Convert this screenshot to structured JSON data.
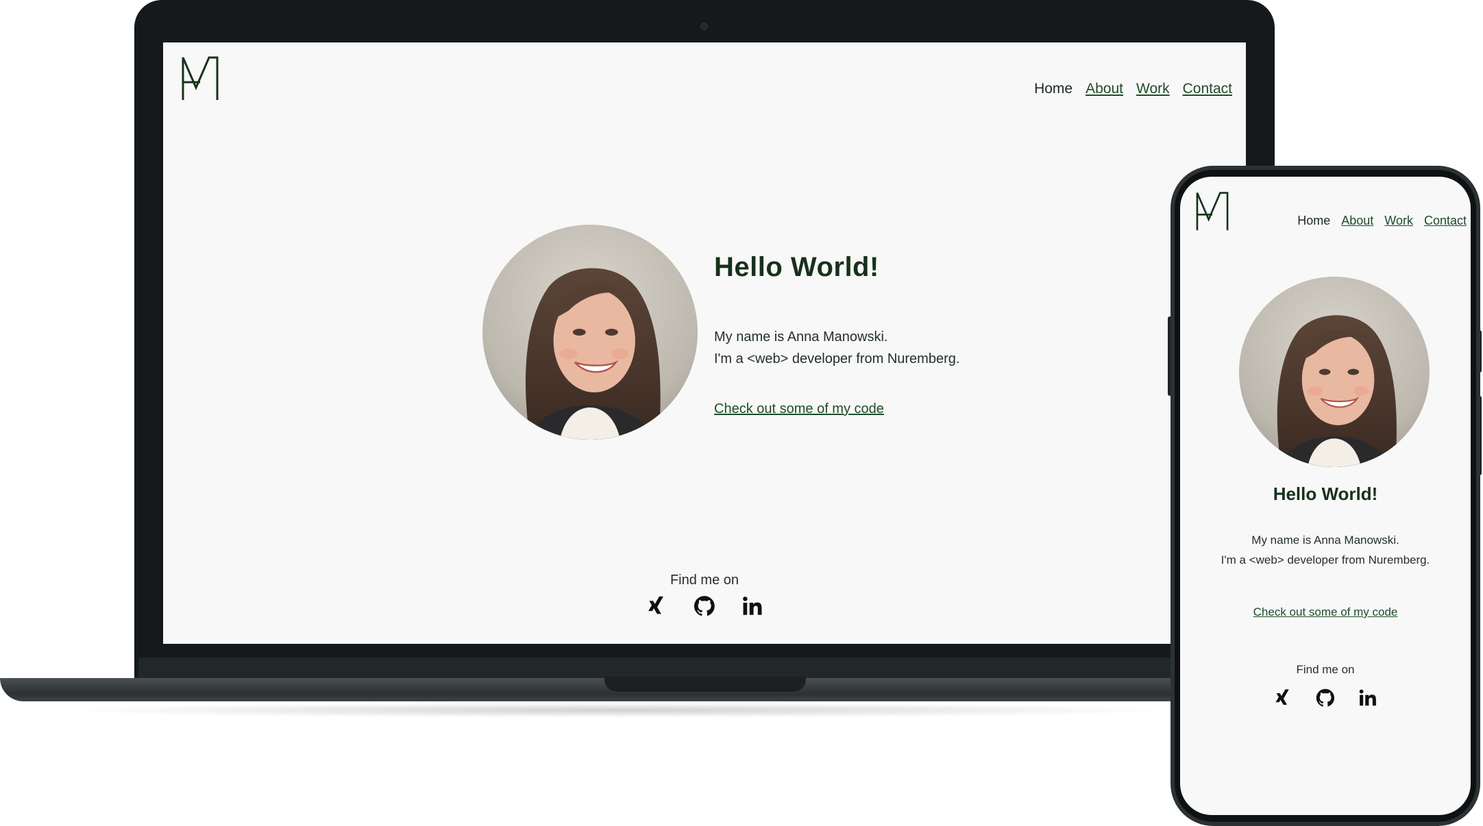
{
  "site": {
    "nav": {
      "home": "Home",
      "about": "About",
      "work": "Work",
      "contact": "Contact"
    },
    "hero": {
      "title": "Hello World!",
      "intro_line1": "My name is Anna Manowski.",
      "intro_line2": "I'm a <web> developer from Nuremberg.",
      "code_link": "Check out some of my code"
    },
    "footer": {
      "find_label": "Find me on"
    },
    "socials": [
      "xing-icon",
      "github-icon",
      "linkedin-icon"
    ]
  },
  "colors": {
    "accent_green": "#1d4d28",
    "heading_green": "#163219",
    "page_background": "#f8f8f8",
    "device_frame": "#15191b"
  }
}
